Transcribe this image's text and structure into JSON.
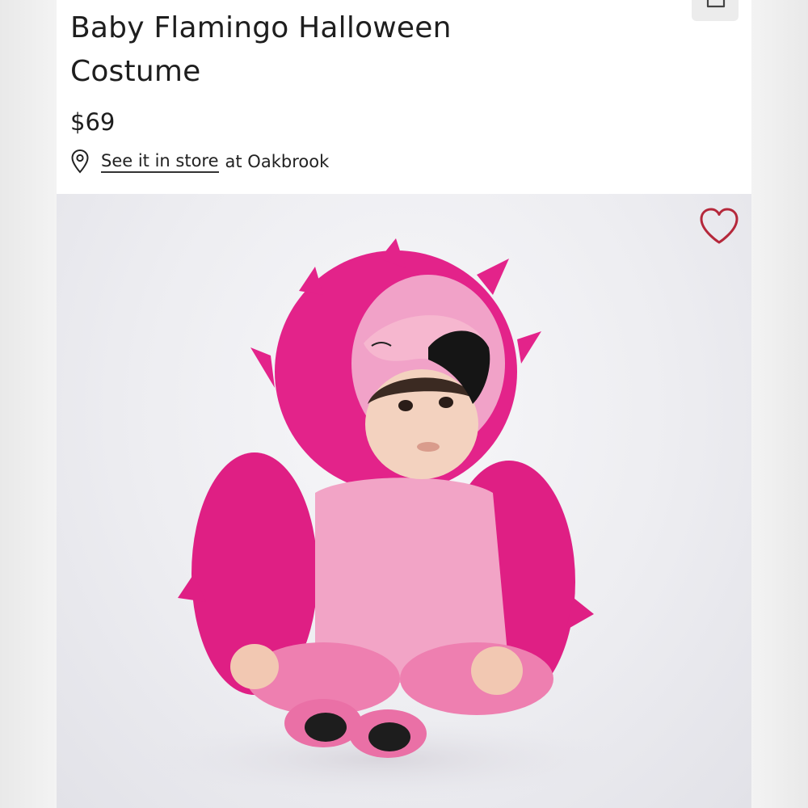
{
  "product": {
    "title": "Baby Flamingo Halloween Costume",
    "price": "$69"
  },
  "store": {
    "link_label": "See it in store",
    "suffix": "at Oakbrook"
  },
  "icons": {
    "share": "share-icon",
    "location": "location-pin-icon",
    "favorite": "heart-icon"
  },
  "colors": {
    "favorite_accent": "#b5283b",
    "costume_pink": "#e8248a"
  }
}
